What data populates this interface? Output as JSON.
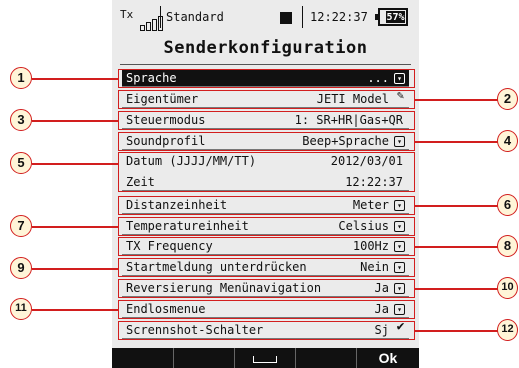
{
  "status": {
    "tx_label": "Tx",
    "model_name": "Standard",
    "time": "12:22:37",
    "battery": "57%"
  },
  "title": "Senderkonfiguration",
  "rows": [
    {
      "label": "Sprache",
      "value": "...",
      "icon": "dropdown-icon"
    },
    {
      "label": "Eigentümer",
      "value": "JETI Model",
      "icon": "edit-icon"
    },
    {
      "label": "Steuermodus",
      "value": "1: SR+HR|Gas+QR"
    },
    {
      "label": "Soundprofil",
      "value": "Beep+Sprache",
      "icon": "dropdown-icon"
    },
    {
      "label": "Datum (JJJJ/MM/TT)",
      "value": "2012/03/01"
    },
    {
      "label": "Zeit",
      "value": "12:22:37"
    },
    {
      "label": "Distanzeinheit",
      "value": "Meter",
      "icon": "dropdown-icon"
    },
    {
      "label": "Temperatureinheit",
      "value": "Celsius",
      "icon": "dropdown-icon"
    },
    {
      "label": "TX Frequency",
      "value": "100Hz",
      "icon": "dropdown-icon"
    },
    {
      "label": "Startmeldung unterdrücken",
      "value": "Nein",
      "icon": "dropdown-icon"
    },
    {
      "label": "Reversierung Menünavigation",
      "value": "Ja",
      "icon": "dropdown-icon"
    },
    {
      "label": "Endlosmenue",
      "value": "Ja",
      "icon": "dropdown-icon"
    },
    {
      "label": "Scrennshot-Schalter",
      "value": "Sj",
      "icon": "check-icon"
    }
  ],
  "callouts": [
    "1",
    "2",
    "3",
    "4",
    "5",
    "6",
    "7",
    "8",
    "9",
    "10",
    "11",
    "12"
  ],
  "bottombar": {
    "btn1": "",
    "btn2": "",
    "btn3": "",
    "btn4": "",
    "ok": "Ok"
  },
  "colors": {
    "highlight": "#d21e1e",
    "callout_fill": "#fff5d8",
    "bar": "#111111"
  }
}
